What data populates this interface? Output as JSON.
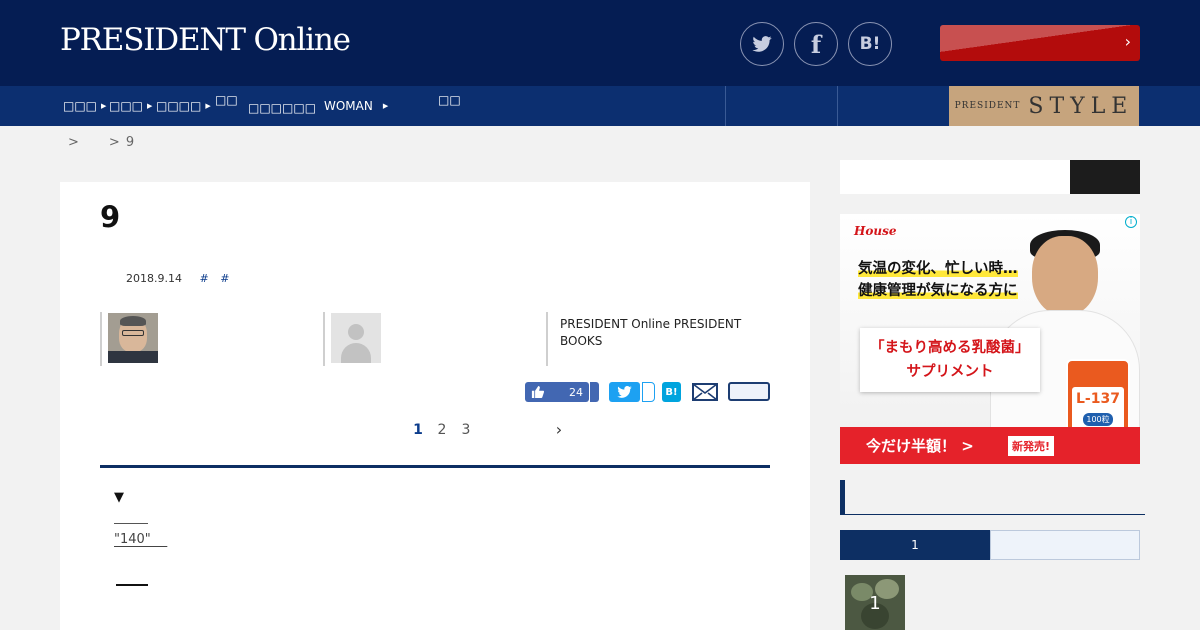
{
  "header": {
    "logo": "PRESIDENT Online",
    "share": {
      "facebook_glyph": "f",
      "hatena_label": "B!"
    },
    "colors": {
      "header_bg": "#051d53",
      "nav_bg": "#0c2f70",
      "accent_red": "#b30c0c"
    }
  },
  "nav": {
    "items": [
      {
        "label": "□□□",
        "has_arrow": true
      },
      {
        "label": "□□□",
        "has_arrow": true
      },
      {
        "label": "□□□□",
        "has_arrow": true
      },
      {
        "label": "□□"
      },
      {
        "label": "□□□□□□"
      },
      {
        "label": "WOMAN",
        "has_arrow": true
      },
      {
        "label": "□□"
      }
    ],
    "style_banner": {
      "prefix": "PRESIDENT",
      "brand": "STYLE"
    }
  },
  "breadcrumb": {
    "sep1": ">",
    "sep2": ">",
    "current": "9"
  },
  "article": {
    "title": "9",
    "date": "2018.9.14",
    "tags": [
      "#",
      "#"
    ],
    "publisher": "PRESIDENT Online PRESIDENT BOOKS",
    "like_count": "24",
    "hatena_label": "B!",
    "pagination": {
      "pages": [
        "1",
        "2",
        "3"
      ],
      "current": "1"
    },
    "arrow_marker": "▼",
    "quote_link": "\"140\"    "
  },
  "sidebar": {
    "ad": {
      "brand": "House",
      "headline_line1": "気温の変化、忙しい時…",
      "headline_line2": "健康管理が気になる方に",
      "product_line1": "「まもり高める乳酸菌」",
      "product_line2": "サプリメント",
      "product_name": "L-137",
      "product_count": "100粒",
      "cta": "今だけ半額！ >",
      "badge": "新発売!",
      "info_glyph": "i"
    },
    "ranking_tab_label": "1",
    "ranking_item_rank": "1"
  }
}
